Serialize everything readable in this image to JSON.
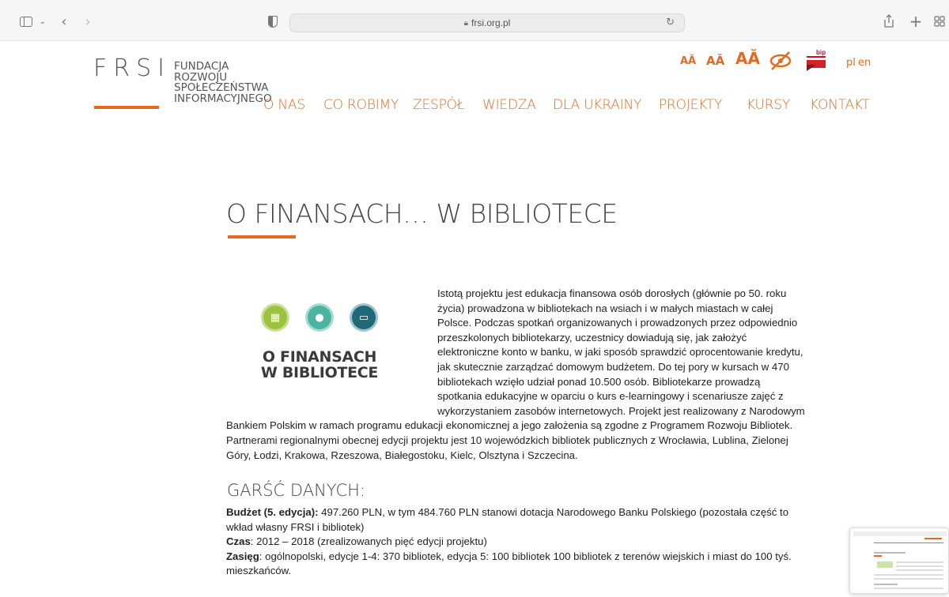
{
  "browser": {
    "url": "frsi.org.pl",
    "icons": [
      "sidebar-icon",
      "chevron-down-icon",
      "back-icon",
      "forward-icon",
      "privacy-shield-icon",
      "lock-icon",
      "reload-icon",
      "share-icon",
      "new-tab-icon",
      "tab-overview-icon"
    ]
  },
  "logo": {
    "letters": "FRSI",
    "lines": [
      "FUNDACJA",
      "ROZWOJU",
      "SPOŁECZEŃSTWA",
      "INFORMACYJNEGO"
    ]
  },
  "accessibility": {
    "font_small": "AǍ",
    "font_medium": "AǍ",
    "font_large": "AǍ",
    "bip_label": "bip"
  },
  "languages": [
    "pl",
    "en"
  ],
  "nav": [
    "O NAS",
    "CO ROBIMY",
    "ZESPÓŁ",
    "WIEDZA",
    "DLA UKRAINY",
    "PROJEKTY",
    "KURSY",
    "KONTAKT"
  ],
  "page": {
    "title": "O FINANSACH… W BIBLIOTECE",
    "project_logo_text": [
      "O FINANSACH",
      "W BIBLIOTECE"
    ],
    "intro": "Istotą projektu jest edukacja finansowa osób dorosłych (głównie po 50. roku życia) prowadzona w bibliotekach na wsiach i w małych miastach w całej Polsce. Podczas spotkań organizowanych i prowadzonych przez odpowiednio przeszkolonych bibliotekarzy, uczestnicy dowiadują się, jak założyć elektroniczne konto w banku, w jaki sposób sprawdzić oprocentowanie kredytu, jak skutecznie zarządzać domowym budżetem. Do tej pory w kursach w 470 bibliotekach wzięło udział ponad 10.500 osób. Bibliotekarze prowadzą spotkania edukacyjne w oparciu o kurs e-learningowy i scenariusze zajęć z wykorzystaniem zasobów internetowych. Projekt jest realizowany z Narodowym Bankiem Polskim w ramach programu edukacji ekonomicznej a jego założenia są zgodne z Programem Rozwoju Bibliotek. Partnerami regionalnymi obecnej edycji projektu jest 10 wojewódzkich bibliotek publicznych z Wrocławia, Lublina, Zielonej Góry, Łodzi, Krakowa, Rzeszowa, Białegostoku, Kielc, Olsztyna i Szczecina.",
    "section_heading": "GARŚĆ DANYCH:",
    "facts": [
      {
        "label": "Budżet (5. edycja):",
        "text": " 497.260 PLN, w tym 484.760 PLN stanowi dotacja Narodowego Banku Polskiego (pozostała część to wkład własny FRSI i bibliotek)"
      },
      {
        "label": "Czas",
        "text": ": 2012 – 2018 (zrealizowanych pięć edycji projektu)"
      },
      {
        "label": "Zasięg",
        "text": ": ogólnopolski, edycje 1-4: 370 bibliotek, edycja 5: 100 bibliotek 100 bibliotek z terenów wiejskich i miast do 100 tyś. mieszkańców."
      }
    ]
  },
  "colors": {
    "accent": "#e56a21",
    "circle1": "#9cc33d",
    "circle2": "#4db3a1",
    "circle3": "#1f6978",
    "bip_red": "#d2232a"
  }
}
